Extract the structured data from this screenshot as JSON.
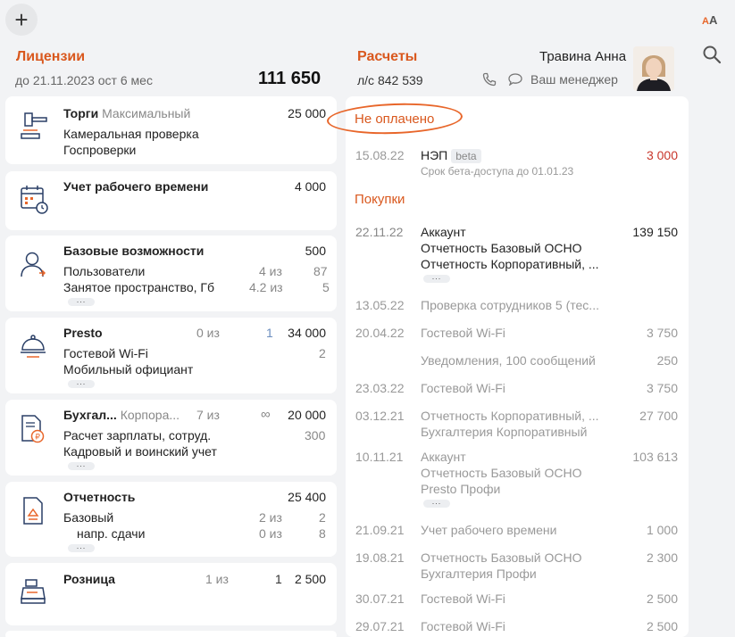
{
  "toolbar": {
    "add_label": "+",
    "font_label_a": "A",
    "font_label_b": "A"
  },
  "licenses": {
    "title": "Лицензии",
    "until": "до 21.11.2023 ост 6 мес",
    "total": "111 650"
  },
  "payments": {
    "title": "Расчеты",
    "account": "л/с 842 539",
    "manager_link": "Ваш менеджер",
    "user_name": "Травина Анна"
  },
  "cards": [
    {
      "name": "Торги",
      "tariff": "Максимальный",
      "price": "25 000",
      "lines": [
        "Камеральная проверка",
        "Госпроверки"
      ]
    },
    {
      "name": "Учет рабочего времени",
      "price": "4 000"
    },
    {
      "name": "Базовые возможности",
      "price": "500",
      "rows": [
        {
          "label": "Пользователи",
          "used": "4 из",
          "total": "87"
        },
        {
          "label": "Занятое пространство, Гб",
          "used": "4.2 из",
          "total": "5"
        }
      ]
    },
    {
      "name": "Presto",
      "used": "0 из",
      "total": "1",
      "price": "34 000",
      "rows": [
        {
          "label": "Гостевой Wi-Fi",
          "total": "2"
        },
        {
          "label": "Мобильный официант"
        }
      ]
    },
    {
      "name": "Бухгал...",
      "tariff": "Корпора...",
      "used": "7 из",
      "total": "∞",
      "price": "20 000",
      "rows": [
        {
          "label": "Расчет зарплаты, сотруд.",
          "total": "300"
        },
        {
          "label": "Кадровый и воинский учет"
        }
      ]
    },
    {
      "name": "Отчетность",
      "price": "25 400",
      "rows": [
        {
          "label": "Базовый",
          "used": "2 из",
          "total": "2"
        },
        {
          "label": "напр. сдачи",
          "used": "0 из",
          "total": "8"
        }
      ]
    },
    {
      "name": "Розница",
      "used": "1 из",
      "total": "1",
      "price": "2 500"
    }
  ],
  "unpaid": {
    "header": "Не оплачено",
    "items": [
      {
        "date": "15.08.22",
        "desc": "НЭП",
        "badge": "beta",
        "note": "Срок бета-доступа до 01.01.23",
        "sum": "3 000"
      }
    ]
  },
  "purchases": {
    "header": "Покупки",
    "items": [
      {
        "date": "22.11.22",
        "lines": [
          "Аккаунт",
          "Отчетность Базовый ОСНО",
          "Отчетность Корпоративный, ..."
        ],
        "sum": "139 150"
      },
      {
        "date": "13.05.22",
        "lines": [
          "Проверка сотрудников 5 (тес..."
        ],
        "sum": ""
      },
      {
        "date": "20.04.22",
        "lines": [
          "Гостевой Wi-Fi"
        ],
        "sum": "3 750"
      },
      {
        "date": "",
        "lines": [
          "Уведомления, 100 сообщений"
        ],
        "sum": "250"
      },
      {
        "date": "23.03.22",
        "lines": [
          "Гостевой Wi-Fi"
        ],
        "sum": "3 750"
      },
      {
        "date": "03.12.21",
        "lines": [
          "Отчетность Корпоративный, ...",
          "Бухгалтерия Корпоративный"
        ],
        "sum": "27 700"
      },
      {
        "date": "10.11.21",
        "lines": [
          "Аккаунт",
          "Отчетность Базовый ОСНО",
          "Presto Профи"
        ],
        "sum": "103 613"
      },
      {
        "date": "21.09.21",
        "lines": [
          "Учет рабочего времени"
        ],
        "sum": "1 000"
      },
      {
        "date": "19.08.21",
        "lines": [
          "Отчетность Базовый ОСНО",
          "Бухгалтерия Профи"
        ],
        "sum": "2 300"
      },
      {
        "date": "30.07.21",
        "lines": [
          "Гостевой Wi-Fi"
        ],
        "sum": "2 500"
      },
      {
        "date": "29.07.21",
        "lines": [
          "Гостевой Wi-Fi"
        ],
        "sum": "2 500"
      }
    ]
  },
  "colors": {
    "accent": "#d9581e",
    "debt": "#c8362b",
    "background": "#f2f3f5"
  },
  "icons": [
    "plus-icon",
    "font-size-icon",
    "search-icon",
    "phone-icon",
    "chat-icon",
    "gavel-icon",
    "calendar-clock-icon",
    "user-icon",
    "cloche-icon",
    "ruble-doc-icon",
    "report-doc-icon",
    "cash-register-icon"
  ]
}
